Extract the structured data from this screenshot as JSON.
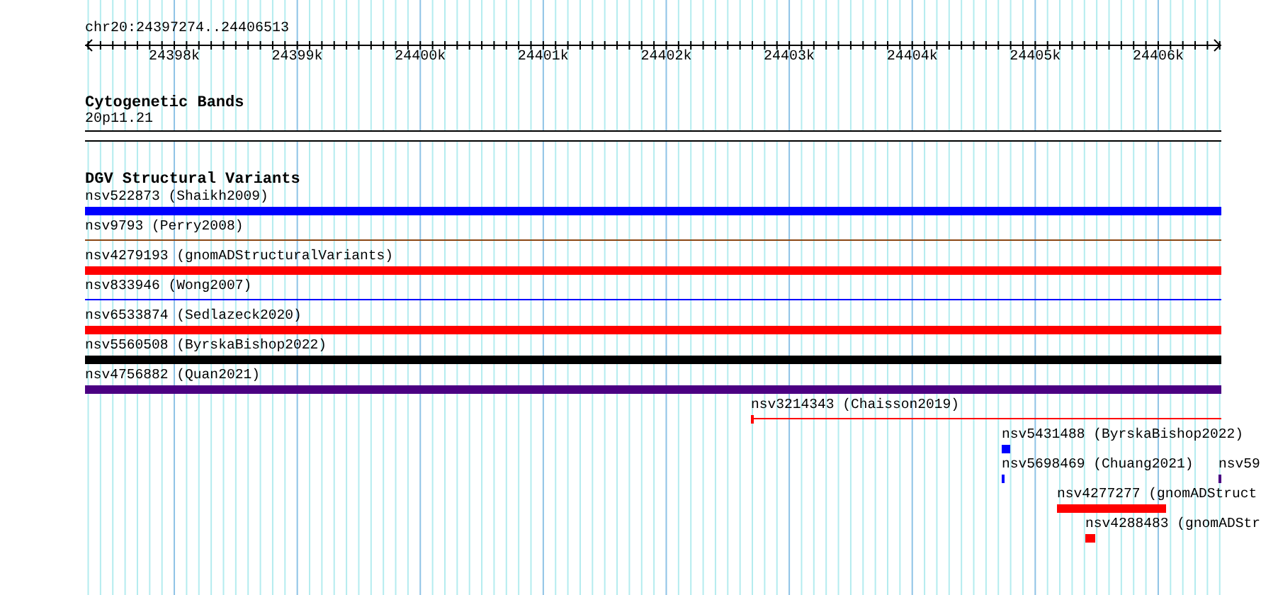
{
  "location": "chr20:24397274..24406513",
  "ruler": {
    "labels": [
      "24398k",
      "24399k",
      "24400k",
      "24401k",
      "24402k",
      "24403k",
      "24404k",
      "24405k",
      "24406k"
    ]
  },
  "tracks": [
    {
      "kind": "bands",
      "title": "Cytogenetic Bands",
      "features": [
        {
          "label": "20p11.21"
        }
      ]
    },
    {
      "kind": "variants",
      "title": "DGV Structural Variants",
      "features": [
        {
          "label": "nsv522873 (Shaikh2009)",
          "kind": "thick",
          "color": "#0000ff"
        },
        {
          "label": "nsv9793 (Perry2008)",
          "kind": "thin",
          "color": "#8b4513"
        },
        {
          "label": "nsv4279193 (gnomADStructuralVariants)",
          "kind": "thick",
          "color": "#ff0000"
        },
        {
          "label": "nsv833946 (Wong2007)",
          "kind": "thin",
          "color": "#0000ff"
        },
        {
          "label": "nsv6533874 (Sedlazeck2020)",
          "kind": "thick",
          "color": "#ff0000"
        },
        {
          "label": "nsv5560508 (ByrskaBishop2022)",
          "kind": "thick",
          "color": "#000000"
        },
        {
          "label": "nsv4756882 (Quan2021)",
          "kind": "thick",
          "color": "#4b0082"
        },
        {
          "label": "nsv3214343 (Chaisson2019)",
          "kind": "thin",
          "color": "#ff0000"
        },
        {
          "label": "nsv5431488 (ByrskaBishop2022)",
          "kind": "thick",
          "color": "#0000ff"
        },
        {
          "label": "nsv5698469 (Chuang2021)",
          "kind": "thick",
          "color": "#0000ff"
        },
        {
          "label": "nsv59",
          "kind": "thick",
          "color": "#4b0082"
        },
        {
          "label": "nsv4277277 (gnomADStruct",
          "kind": "thick",
          "color": "#ff0000"
        },
        {
          "label": "nsv4288483 (gnomADStr",
          "kind": "thick",
          "color": "#ff0000"
        }
      ]
    }
  ]
}
